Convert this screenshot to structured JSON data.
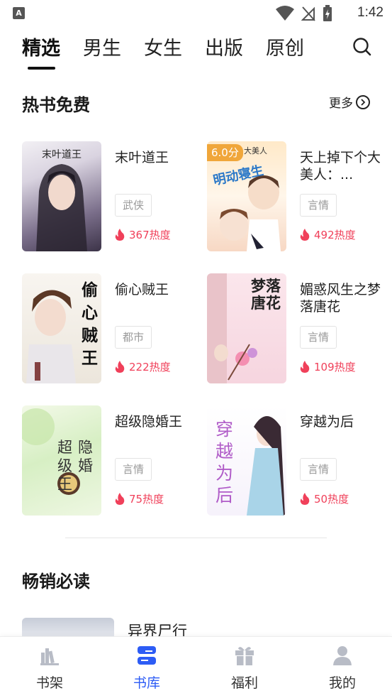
{
  "status_bar": {
    "time": "1:42",
    "app_icon": "A"
  },
  "tabs": [
    {
      "label": "精选",
      "active": true
    },
    {
      "label": "男生",
      "active": false
    },
    {
      "label": "女生",
      "active": false
    },
    {
      "label": "出版",
      "active": false
    },
    {
      "label": "原创",
      "active": false
    }
  ],
  "hot_free": {
    "title": "热书免费",
    "more": "更多",
    "books": [
      {
        "title": "末叶道王",
        "genre": "武侠",
        "heat": "367热度",
        "cover_text": "末叶道王"
      },
      {
        "title": "天上掉下个大美人：...",
        "genre": "言情",
        "heat": "492热度",
        "score": "6.0分",
        "cover_text": "明动寝生",
        "cover_text2": "大美人"
      },
      {
        "title": "偷心贼王",
        "genre": "都市",
        "heat": "222热度",
        "cover_text": "偷心贼王"
      },
      {
        "title": "媚惑风生之梦落唐花",
        "genre": "言情",
        "heat": "109热度",
        "cover_text": "梦落唐花"
      },
      {
        "title": "超级隐婚王",
        "genre": "言情",
        "heat": "75热度",
        "cover_text": "超隐级婚王"
      },
      {
        "title": "穿越为后",
        "genre": "言情",
        "heat": "50热度",
        "cover_text": "穿越为后"
      }
    ]
  },
  "bestseller": {
    "title": "畅销必读",
    "books": [
      {
        "title": "异界尸行"
      }
    ]
  },
  "bottom_nav": [
    {
      "label": "书架",
      "icon": "bookshelf-icon",
      "active": false
    },
    {
      "label": "书库",
      "icon": "library-icon",
      "active": true
    },
    {
      "label": "福利",
      "icon": "gift-icon",
      "active": false
    },
    {
      "label": "我的",
      "icon": "profile-icon",
      "active": false
    }
  ],
  "colors": {
    "accent": "#2d5cf5",
    "heat": "#f0405a",
    "score_badge": "#f0a63a"
  }
}
